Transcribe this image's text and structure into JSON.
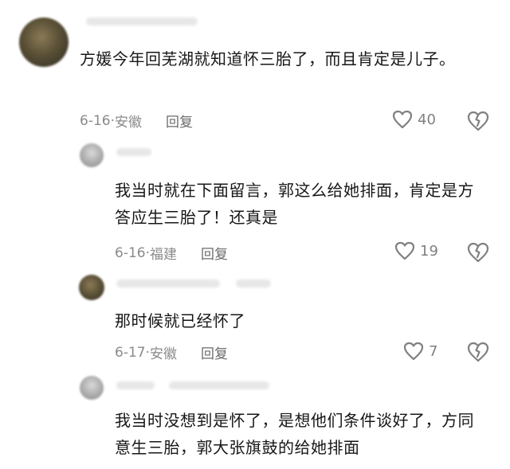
{
  "comments": [
    {
      "text": "方媛今年回芜湖就知道怀三胎了，而且肯定是儿子。",
      "date": "6-16",
      "location": "安徽",
      "reply_label": "回复",
      "likes": "40"
    },
    {
      "text": "我当时就在下面留言，郭这么给她排面，肯定是方答应生三胎了！还真是",
      "date": "6-16",
      "location": "福建",
      "reply_label": "回复",
      "likes": "19"
    },
    {
      "text": "那时候就已经怀了",
      "date": "6-17",
      "location": "安徽",
      "reply_label": "回复",
      "likes": "7"
    },
    {
      "text": "我当时没想到是怀了，是想他们条件谈好了，方同意生三胎，郭大张旗鼓的给她排面"
    }
  ],
  "icons": {
    "like": "heart-outline-icon",
    "dislike": "broken-heart-icon"
  },
  "colors": {
    "text": "#171717",
    "meta": "#8a8a8a",
    "icon": "#808080"
  }
}
